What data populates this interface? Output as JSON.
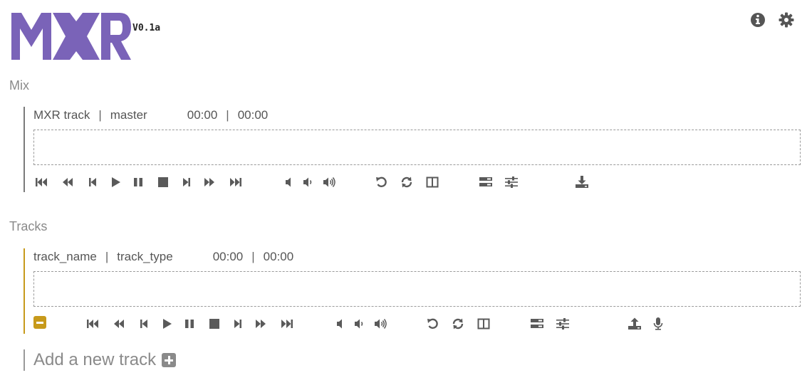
{
  "app": {
    "logo_text": "MXR",
    "version": "V0.1a",
    "logo_color": "#7a63b8"
  },
  "header_icons": [
    "info-icon",
    "gear-icon"
  ],
  "mix": {
    "section_title": "Mix",
    "track": {
      "name": "MXR track",
      "type": "master",
      "current_time": "00:00",
      "duration": "00:00"
    }
  },
  "tracks": {
    "section_title": "Tracks",
    "items": [
      {
        "name": "track_name",
        "type": "track_type",
        "current_time": "00:00",
        "duration": "00:00",
        "accent_color": "#c79a1b"
      }
    ]
  },
  "add_track": {
    "label": "Add a new track"
  },
  "controls": {
    "transport": [
      "skip-to-start-icon",
      "fast-backward-icon",
      "step-backward-icon",
      "play-icon",
      "pause-icon",
      "stop-icon",
      "step-forward-icon",
      "fast-forward-icon",
      "skip-to-end-icon"
    ],
    "volume": [
      "volume-mute-icon",
      "volume-down-icon",
      "volume-up-icon"
    ],
    "loop": [
      "undo-icon",
      "loop-icon",
      "split-view-icon"
    ],
    "mixer": [
      "tracks-icon",
      "sliders-icon"
    ],
    "mix_extra": [
      "download-icon"
    ],
    "track_extra": [
      "upload-icon",
      "microphone-icon"
    ]
  },
  "colors": {
    "icon": "#555555",
    "master_border": "#7a7a7a",
    "track_border": "#c79a1b"
  }
}
